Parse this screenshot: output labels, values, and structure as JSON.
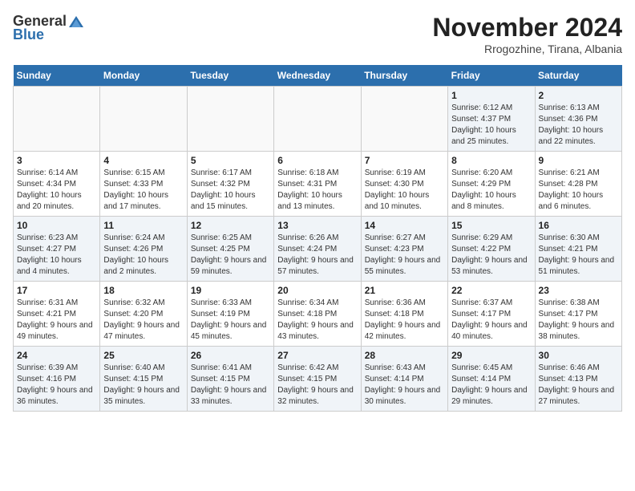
{
  "logo": {
    "general": "General",
    "blue": "Blue"
  },
  "header": {
    "month": "November 2024",
    "location": "Rrogozhine, Tirana, Albania"
  },
  "weekdays": [
    "Sunday",
    "Monday",
    "Tuesday",
    "Wednesday",
    "Thursday",
    "Friday",
    "Saturday"
  ],
  "weeks": [
    [
      {
        "day": "",
        "info": ""
      },
      {
        "day": "",
        "info": ""
      },
      {
        "day": "",
        "info": ""
      },
      {
        "day": "",
        "info": ""
      },
      {
        "day": "",
        "info": ""
      },
      {
        "day": "1",
        "info": "Sunrise: 6:12 AM\nSunset: 4:37 PM\nDaylight: 10 hours and 25 minutes."
      },
      {
        "day": "2",
        "info": "Sunrise: 6:13 AM\nSunset: 4:36 PM\nDaylight: 10 hours and 22 minutes."
      }
    ],
    [
      {
        "day": "3",
        "info": "Sunrise: 6:14 AM\nSunset: 4:34 PM\nDaylight: 10 hours and 20 minutes."
      },
      {
        "day": "4",
        "info": "Sunrise: 6:15 AM\nSunset: 4:33 PM\nDaylight: 10 hours and 17 minutes."
      },
      {
        "day": "5",
        "info": "Sunrise: 6:17 AM\nSunset: 4:32 PM\nDaylight: 10 hours and 15 minutes."
      },
      {
        "day": "6",
        "info": "Sunrise: 6:18 AM\nSunset: 4:31 PM\nDaylight: 10 hours and 13 minutes."
      },
      {
        "day": "7",
        "info": "Sunrise: 6:19 AM\nSunset: 4:30 PM\nDaylight: 10 hours and 10 minutes."
      },
      {
        "day": "8",
        "info": "Sunrise: 6:20 AM\nSunset: 4:29 PM\nDaylight: 10 hours and 8 minutes."
      },
      {
        "day": "9",
        "info": "Sunrise: 6:21 AM\nSunset: 4:28 PM\nDaylight: 10 hours and 6 minutes."
      }
    ],
    [
      {
        "day": "10",
        "info": "Sunrise: 6:23 AM\nSunset: 4:27 PM\nDaylight: 10 hours and 4 minutes."
      },
      {
        "day": "11",
        "info": "Sunrise: 6:24 AM\nSunset: 4:26 PM\nDaylight: 10 hours and 2 minutes."
      },
      {
        "day": "12",
        "info": "Sunrise: 6:25 AM\nSunset: 4:25 PM\nDaylight: 9 hours and 59 minutes."
      },
      {
        "day": "13",
        "info": "Sunrise: 6:26 AM\nSunset: 4:24 PM\nDaylight: 9 hours and 57 minutes."
      },
      {
        "day": "14",
        "info": "Sunrise: 6:27 AM\nSunset: 4:23 PM\nDaylight: 9 hours and 55 minutes."
      },
      {
        "day": "15",
        "info": "Sunrise: 6:29 AM\nSunset: 4:22 PM\nDaylight: 9 hours and 53 minutes."
      },
      {
        "day": "16",
        "info": "Sunrise: 6:30 AM\nSunset: 4:21 PM\nDaylight: 9 hours and 51 minutes."
      }
    ],
    [
      {
        "day": "17",
        "info": "Sunrise: 6:31 AM\nSunset: 4:21 PM\nDaylight: 9 hours and 49 minutes."
      },
      {
        "day": "18",
        "info": "Sunrise: 6:32 AM\nSunset: 4:20 PM\nDaylight: 9 hours and 47 minutes."
      },
      {
        "day": "19",
        "info": "Sunrise: 6:33 AM\nSunset: 4:19 PM\nDaylight: 9 hours and 45 minutes."
      },
      {
        "day": "20",
        "info": "Sunrise: 6:34 AM\nSunset: 4:18 PM\nDaylight: 9 hours and 43 minutes."
      },
      {
        "day": "21",
        "info": "Sunrise: 6:36 AM\nSunset: 4:18 PM\nDaylight: 9 hours and 42 minutes."
      },
      {
        "day": "22",
        "info": "Sunrise: 6:37 AM\nSunset: 4:17 PM\nDaylight: 9 hours and 40 minutes."
      },
      {
        "day": "23",
        "info": "Sunrise: 6:38 AM\nSunset: 4:17 PM\nDaylight: 9 hours and 38 minutes."
      }
    ],
    [
      {
        "day": "24",
        "info": "Sunrise: 6:39 AM\nSunset: 4:16 PM\nDaylight: 9 hours and 36 minutes."
      },
      {
        "day": "25",
        "info": "Sunrise: 6:40 AM\nSunset: 4:15 PM\nDaylight: 9 hours and 35 minutes."
      },
      {
        "day": "26",
        "info": "Sunrise: 6:41 AM\nSunset: 4:15 PM\nDaylight: 9 hours and 33 minutes."
      },
      {
        "day": "27",
        "info": "Sunrise: 6:42 AM\nSunset: 4:15 PM\nDaylight: 9 hours and 32 minutes."
      },
      {
        "day": "28",
        "info": "Sunrise: 6:43 AM\nSunset: 4:14 PM\nDaylight: 9 hours and 30 minutes."
      },
      {
        "day": "29",
        "info": "Sunrise: 6:45 AM\nSunset: 4:14 PM\nDaylight: 9 hours and 29 minutes."
      },
      {
        "day": "30",
        "info": "Sunrise: 6:46 AM\nSunset: 4:13 PM\nDaylight: 9 hours and 27 minutes."
      }
    ]
  ]
}
